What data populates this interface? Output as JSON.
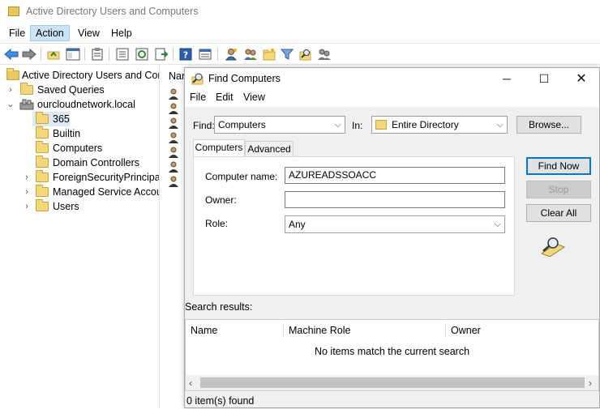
{
  "window": {
    "title": "Active Directory Users and Computers"
  },
  "menubar": {
    "items": [
      "File",
      "Action",
      "View",
      "Help"
    ]
  },
  "tree": {
    "root": "Active Directory Users and Com",
    "saved_queries": "Saved Queries",
    "domain": "ourcloudnetwork.local",
    "children": [
      "365",
      "Builtin",
      "Computers",
      "Domain Controllers",
      "ForeignSecurityPrincipals",
      "Managed Service Accour",
      "Users"
    ]
  },
  "listpane": {
    "col_name": "Nar"
  },
  "dialog": {
    "title": "Find Computers",
    "menu": [
      "File",
      "Edit",
      "View"
    ],
    "find_label": "Find:",
    "find_value": "Computers",
    "in_label": "In:",
    "in_value": "Entire Directory",
    "browse_button": "Browse...",
    "tabs": [
      "Computers",
      "Advanced"
    ],
    "computer_name_label": "Computer name:",
    "computer_name_value": "AZUREADSSOACC",
    "owner_label": "Owner:",
    "owner_value": "",
    "role_label": "Role:",
    "role_value": "Any",
    "find_now_button": "Find Now",
    "stop_button": "Stop",
    "clear_all_button": "Clear All",
    "search_results_label": "Search results:",
    "columns": [
      "Name",
      "Machine Role",
      "Owner"
    ],
    "empty_message": "No items match the current search",
    "status": "0 item(s) found"
  }
}
